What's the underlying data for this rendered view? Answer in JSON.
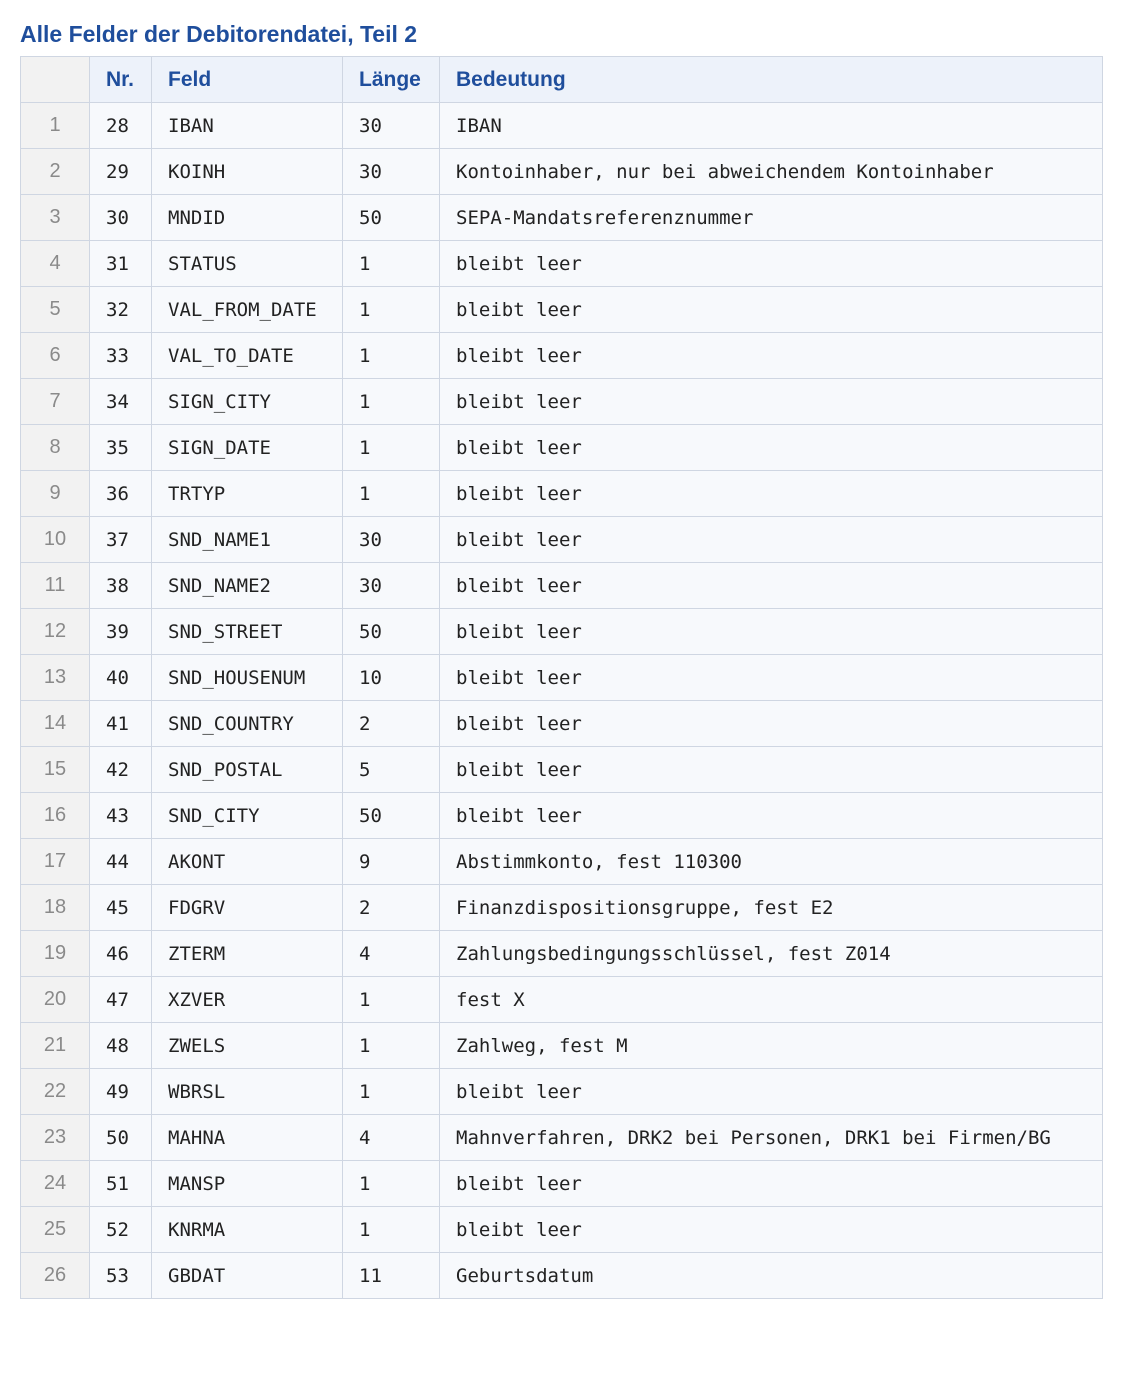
{
  "title": "Alle Felder der Debitorendatei, Teil 2",
  "table": {
    "headers": [
      "",
      "Nr.",
      "Feld",
      "Länge",
      "Bedeutung"
    ],
    "rows": [
      [
        "1",
        "28",
        "IBAN",
        "30",
        "IBAN"
      ],
      [
        "2",
        "29",
        "KOINH",
        "30",
        "Kontoinhaber, nur bei abweichendem Kontoinhaber"
      ],
      [
        "3",
        "30",
        "MNDID",
        "50",
        "SEPA-Mandatsreferenznummer"
      ],
      [
        "4",
        "31",
        "STATUS",
        "1",
        "bleibt leer"
      ],
      [
        "5",
        "32",
        "VAL_FROM_DATE",
        "1",
        "bleibt leer"
      ],
      [
        "6",
        "33",
        "VAL_TO_DATE",
        "1",
        "bleibt leer"
      ],
      [
        "7",
        "34",
        "SIGN_CITY",
        "1",
        "bleibt leer"
      ],
      [
        "8",
        "35",
        "SIGN_DATE",
        "1",
        "bleibt leer"
      ],
      [
        "9",
        "36",
        "TRTYP",
        "1",
        "bleibt leer"
      ],
      [
        "10",
        "37",
        "SND_NAME1",
        "30",
        "bleibt leer"
      ],
      [
        "11",
        "38",
        "SND_NAME2",
        "30",
        "bleibt leer"
      ],
      [
        "12",
        "39",
        "SND_STREET",
        "50",
        "bleibt leer"
      ],
      [
        "13",
        "40",
        "SND_HOUSENUM",
        "10",
        "bleibt leer"
      ],
      [
        "14",
        "41",
        "SND_COUNTRY",
        "2",
        "bleibt leer"
      ],
      [
        "15",
        "42",
        "SND_POSTAL",
        "5",
        "bleibt leer"
      ],
      [
        "16",
        "43",
        "SND_CITY",
        "50",
        "bleibt leer"
      ],
      [
        "17",
        "44",
        "AKONT",
        "9",
        "Abstimmkonto, fest 110300"
      ],
      [
        "18",
        "45",
        "FDGRV",
        "2",
        "Finanzdispositionsgruppe, fest E2"
      ],
      [
        "19",
        "46",
        "ZTERM",
        "4",
        "Zahlungsbedingungsschlüssel, fest Z014"
      ],
      [
        "20",
        "47",
        "XZVER",
        "1",
        "fest X"
      ],
      [
        "21",
        "48",
        "ZWELS",
        "1",
        "Zahlweg, fest M"
      ],
      [
        "22",
        "49",
        "WBRSL",
        "1",
        "bleibt leer"
      ],
      [
        "23",
        "50",
        "MAHNA",
        "4",
        "Mahnverfahren, DRK2 bei Personen, DRK1 bei Firmen/BG"
      ],
      [
        "24",
        "51",
        "MANSP",
        "1",
        "bleibt leer"
      ],
      [
        "25",
        "52",
        "KNRMA",
        "1",
        "bleibt leer"
      ],
      [
        "26",
        "53",
        "GBDAT",
        "11",
        "Geburtsdatum"
      ]
    ]
  },
  "colors": {
    "title": "#1f4e9c",
    "header_bg": "#edf2fa",
    "index_bg": "#f2f2f2",
    "cell_bg": "#f7f9fc",
    "border": "#cfd6e2"
  }
}
